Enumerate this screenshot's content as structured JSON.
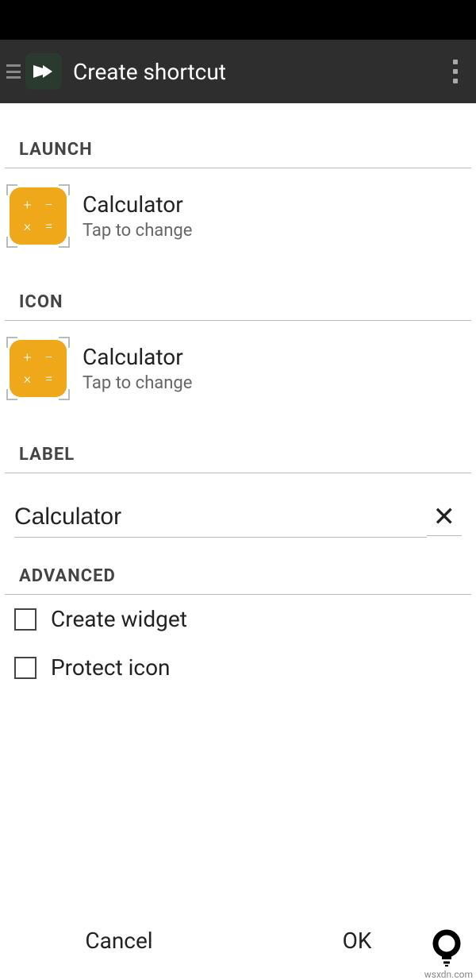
{
  "header": {
    "title": "Create shortcut"
  },
  "sections": {
    "launch": {
      "header": "LAUNCH",
      "title": "Calculator",
      "sub": "Tap to change"
    },
    "icon": {
      "header": "ICON",
      "title": "Calculator",
      "sub": "Tap to change"
    },
    "label": {
      "header": "LABEL",
      "value": "Calculator"
    },
    "advanced": {
      "header": "ADVANCED",
      "create_widget": "Create widget",
      "protect_icon": "Protect icon"
    }
  },
  "footer": {
    "cancel": "Cancel",
    "ok": "OK"
  },
  "watermark": "wsxdn.com"
}
